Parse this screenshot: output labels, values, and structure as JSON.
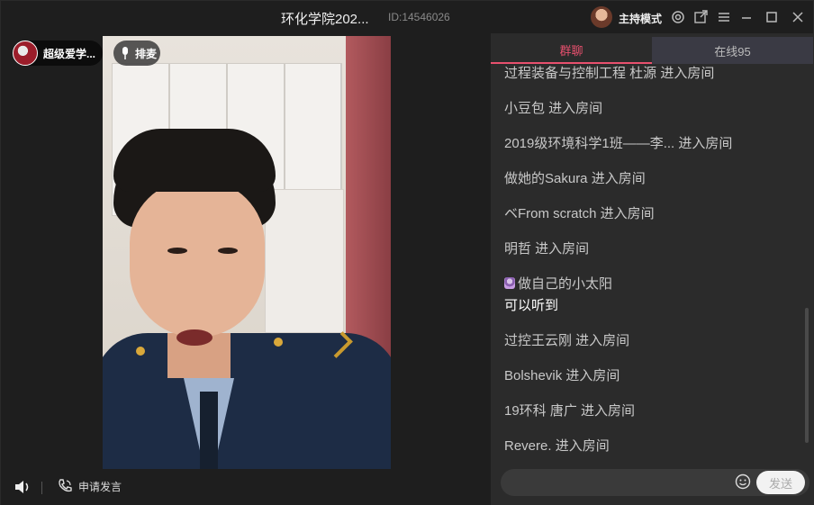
{
  "window": {
    "title": "环化学院202...",
    "room_id": "ID:14546026",
    "host_mode_label": "主持模式"
  },
  "titlebar_icons": [
    "settings-icon",
    "popout-icon",
    "menu-icon",
    "minimize-icon",
    "maximize-icon",
    "close-icon"
  ],
  "stage": {
    "user_name": "超级爱学...",
    "queue_label": "排麦",
    "apply_label": "申请发言"
  },
  "chat": {
    "tabs": [
      {
        "label": "群聊",
        "active": true
      },
      {
        "label": "在线95",
        "active": false
      }
    ],
    "messages": [
      {
        "text": "过程装备与控制工程 杜源 进入房间",
        "white": false
      },
      {
        "text": "小豆包 进入房间",
        "white": false
      },
      {
        "text": "2019级环境科学1班——李... 进入房间",
        "white": false
      },
      {
        "text": "做她的Sakura 进入房间",
        "white": false
      },
      {
        "text": "ベFrom scratch 进入房间",
        "white": false
      },
      {
        "text": "明哲 进入房间",
        "white": false
      },
      {
        "text": "做自己的小太阳",
        "white": false,
        "emoji": true
      },
      {
        "text": "可以听到",
        "white": true
      },
      {
        "text": "过控王云刚 进入房间",
        "white": false
      },
      {
        "text": "Bolshevik 进入房间",
        "white": false
      },
      {
        "text": "19环科 唐广 进入房间",
        "white": false
      },
      {
        "text": "Revere. 进入房间",
        "white": false
      }
    ],
    "input_placeholder": "",
    "send_label": "发送"
  },
  "colors": {
    "accent": "#e8506e",
    "background": "#1e1e1e",
    "chat_background": "#2b2b2b"
  }
}
